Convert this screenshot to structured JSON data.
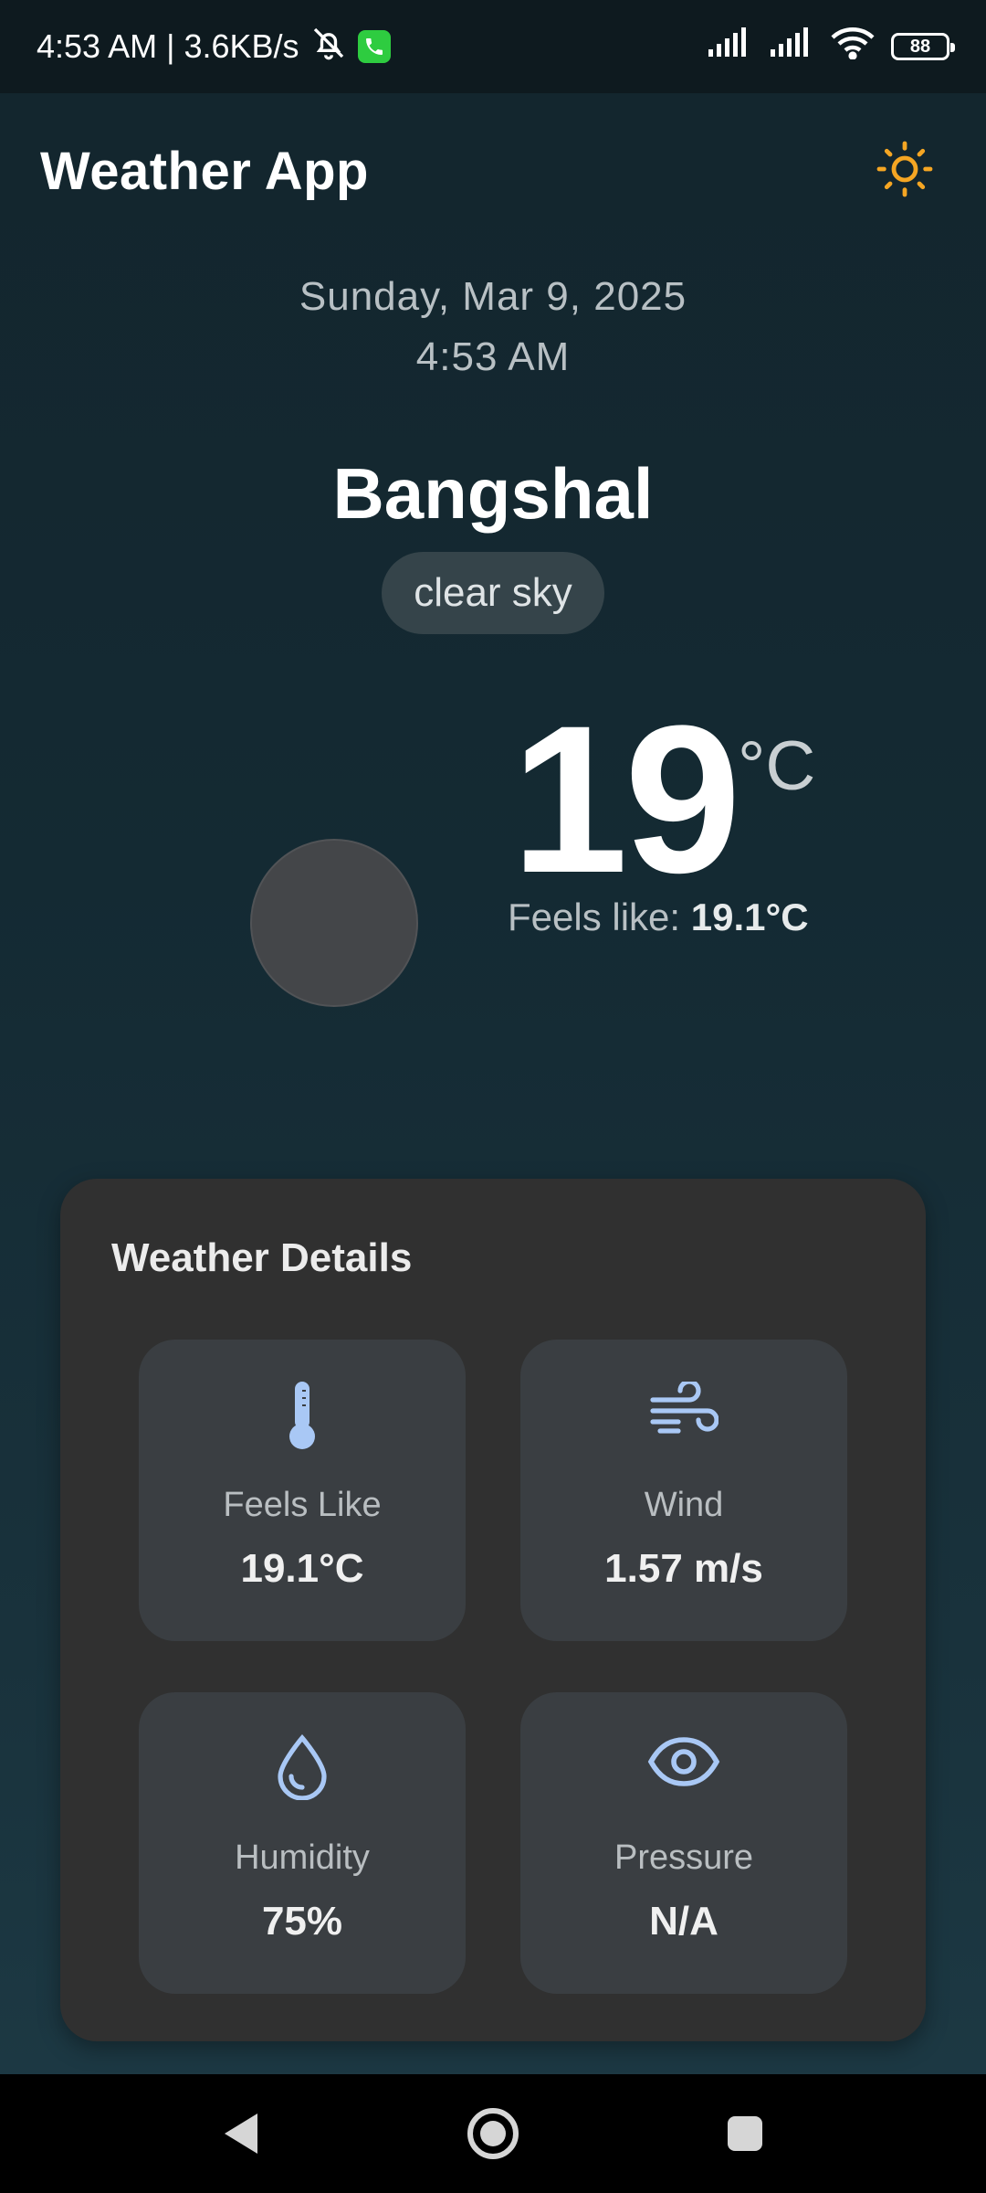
{
  "status_bar": {
    "time_speed": "4:53 AM | 3.6KB/s",
    "battery": "88"
  },
  "app_bar": {
    "title": "Weather App",
    "theme_icon": "sun-icon"
  },
  "date": {
    "date_text": "Sunday, Mar 9, 2025",
    "time_text": "4:53 AM"
  },
  "location": {
    "city": "Bangshal",
    "condition": "clear sky"
  },
  "current": {
    "temperature": "19",
    "unit": "°C",
    "feels_like_label": "Feels like: ",
    "feels_like_value": "19.1°C"
  },
  "details": {
    "title": "Weather Details",
    "items": [
      {
        "icon": "thermometer-icon",
        "label": "Feels Like",
        "value": "19.1°C"
      },
      {
        "icon": "wind-icon",
        "label": "Wind",
        "value": "1.57 m/s"
      },
      {
        "icon": "water-drop-icon",
        "label": "Humidity",
        "value": "75%"
      },
      {
        "icon": "eye-icon",
        "label": "Pressure",
        "value": "N/A"
      }
    ]
  },
  "colors": {
    "accent_sun": "#f5a623",
    "icon_blue": "#a9c8f5",
    "card_bg": "#303030",
    "tile_bg": "#3a3e42"
  }
}
